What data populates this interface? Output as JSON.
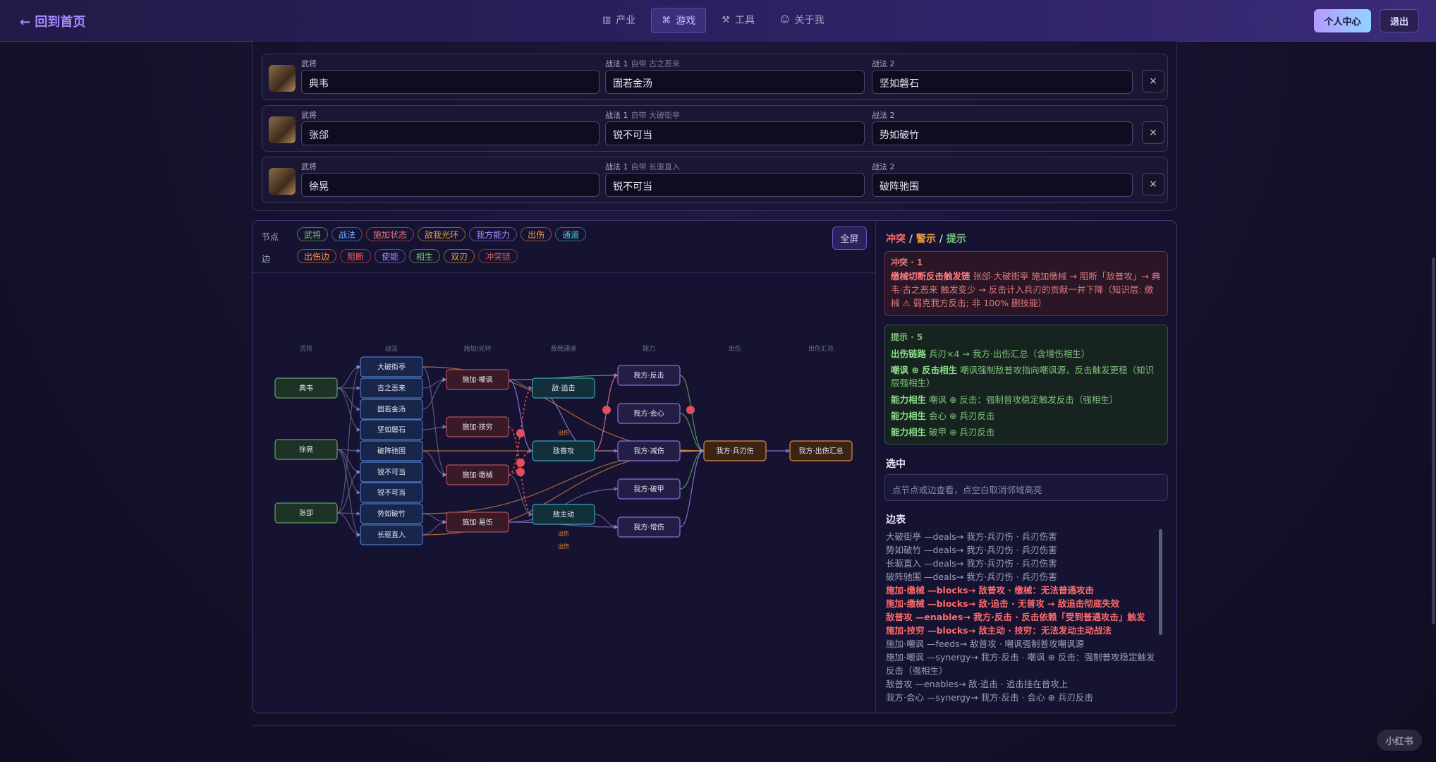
{
  "topbar": {
    "back_label": "← 回到首页",
    "nav": [
      {
        "icon": "bar-chart-icon",
        "glyph": "▥",
        "label": "产业"
      },
      {
        "icon": "gamepad-icon",
        "glyph": "⌘",
        "label": "游戏"
      },
      {
        "icon": "wrench-icon",
        "glyph": "⚒",
        "label": "工具"
      },
      {
        "icon": "user-icon",
        "glyph": "☺",
        "label": "关于我"
      }
    ],
    "profile_label": "个人中心",
    "logout_label": "退出"
  },
  "team": {
    "rows": [
      {
        "hero_label": "武将",
        "hero": "典韦",
        "skill1_label": "战法 1",
        "skill1_sub": "自带 古之恶来",
        "skill1": "固若金汤",
        "skill2_label": "战法 2",
        "skill2": "坚如磐石",
        "remove": "×"
      },
      {
        "hero_label": "武将",
        "hero": "张郃",
        "skill1_label": "战法 1",
        "skill1_sub": "自带 大破街亭",
        "skill1": "锐不可当",
        "skill2_label": "战法 2",
        "skill2": "势如破竹",
        "remove": "×"
      },
      {
        "hero_label": "武将",
        "hero": "徐晃",
        "skill1_label": "战法 1",
        "skill1_sub": "自带 长驱直入",
        "skill1": "锐不可当",
        "skill2_label": "战法 2",
        "skill2": "破阵驰围",
        "remove": "×"
      }
    ]
  },
  "filters": {
    "node_label": "节点",
    "edge_label": "边",
    "nodes": [
      {
        "label": "武将",
        "color": "#7ac27a"
      },
      {
        "label": "战法",
        "color": "#6fa8ff"
      },
      {
        "label": "施加状态",
        "color": "#e0707a"
      },
      {
        "label": "敌我光环",
        "color": "#e0a050"
      },
      {
        "label": "我方能力",
        "color": "#b08aff"
      },
      {
        "label": "出伤",
        "color": "#ff9a50"
      },
      {
        "label": "通道",
        "color": "#4fc3d8"
      }
    ],
    "edges": [
      {
        "label": "出伤边",
        "color": "#ff9a50"
      },
      {
        "label": "阻断",
        "color": "#ff5f5f"
      },
      {
        "label": "使能",
        "color": "#b08aff"
      },
      {
        "label": "相生",
        "color": "#7ac27a"
      },
      {
        "label": "双刃",
        "color": "#e0a050"
      },
      {
        "label": "冲突链",
        "color": "#e05a5a"
      }
    ],
    "fullscreen_label": "全屏"
  },
  "graph": {
    "columns": [
      "武将",
      "战法",
      "施加/光环",
      "敌我通道",
      "能力",
      "出伤",
      "出伤汇总"
    ],
    "nodes": [
      {
        "id": "hero-dianwei",
        "label": "典韦",
        "type": "hero"
      },
      {
        "id": "hero-xuhuang",
        "label": "徐晃",
        "type": "hero"
      },
      {
        "id": "hero-zhanghe",
        "label": "张郃",
        "type": "hero"
      },
      {
        "id": "sk-dapo",
        "label": "大破街亭",
        "type": "skill"
      },
      {
        "id": "sk-guzhi",
        "label": "古之恶来",
        "type": "skill"
      },
      {
        "id": "sk-guruo",
        "label": "固若金汤",
        "type": "skill"
      },
      {
        "id": "sk-jianru",
        "label": "坚如磐石",
        "type": "skill"
      },
      {
        "id": "sk-pozhen",
        "label": "破阵驰围",
        "type": "skill"
      },
      {
        "id": "sk-rui1",
        "label": "锐不可当",
        "type": "skill"
      },
      {
        "id": "sk-rui2",
        "label": "锐不可当",
        "type": "skill"
      },
      {
        "id": "sk-shiru",
        "label": "势如破竹",
        "type": "skill"
      },
      {
        "id": "sk-changqu",
        "label": "长驱直入",
        "type": "skill"
      },
      {
        "id": "st-chaofeng",
        "label": "施加·嘲讽",
        "type": "state"
      },
      {
        "id": "st-jiqiong",
        "label": "施加·技穷",
        "type": "state"
      },
      {
        "id": "st-jiaoxie",
        "label": "施加·缴械",
        "type": "state"
      },
      {
        "id": "st-yishang",
        "label": "施加·易伤",
        "type": "state"
      },
      {
        "id": "ch-zhuiji",
        "label": "敌·追击",
        "type": "channel"
      },
      {
        "id": "ch-putong",
        "label": "敌普攻",
        "type": "channel"
      },
      {
        "id": "ch-zhudong",
        "label": "敌主动",
        "type": "channel"
      },
      {
        "id": "ab-fanji",
        "label": "我方·反击",
        "type": "ability"
      },
      {
        "id": "ab-huixin",
        "label": "我方·会心",
        "type": "ability"
      },
      {
        "id": "ab-jianshang",
        "label": "我方·减伤",
        "type": "ability"
      },
      {
        "id": "ab-pojia",
        "label": "我方·破甲",
        "type": "ability"
      },
      {
        "id": "ab-zengshang",
        "label": "我方·增伤",
        "type": "ability"
      },
      {
        "id": "dmg-bingren",
        "label": "我方·兵刃伤",
        "type": "damage"
      },
      {
        "id": "dmg-total",
        "label": "我方·出伤汇总",
        "type": "total"
      }
    ],
    "edge_tags": [
      "出伤",
      "出伤",
      "出伤"
    ]
  },
  "sidebar": {
    "title_conflict": "冲突",
    "title_sep": " / ",
    "title_warn": "警示",
    "title_hint": "提示",
    "conflict_head": "冲突 · 1",
    "conflict_bold": "缴械切断反击触发链",
    "conflict_text": " 张郃·大破街亭 施加缴械 → 阻断「敌普攻」→ 典韦·古之恶来 触发变少 → 反击计入兵刃的贡献一并下降（知识层: 缴械 ⚠ 弱克我方反击; 非 100% 删技能）",
    "hint_head": "提示 · 5",
    "hints": [
      {
        "bold": "出伤链路",
        "text": " 兵刃×4 → 我方·出伤汇总（含增伤相生）"
      },
      {
        "bold": "嘲讽 ⊕ 反击相生",
        "text": " 嘲讽强制敌普攻指向嘲讽源，反击触发更稳（知识层强相生）"
      },
      {
        "bold": "能力相生",
        "text": " 嘲讽 ⊕ 反击：强制普攻稳定触发反击（强相生）"
      },
      {
        "bold": "能力相生",
        "text": " 会心 ⊕ 兵刃反击"
      },
      {
        "bold": "能力相生",
        "text": " 破甲 ⊕ 兵刃反击"
      }
    ],
    "selected_title": "选中",
    "selected_placeholder": "点节点或边查看，点空白取消邻域高亮",
    "edges_title": "边表",
    "edge_list": [
      {
        "text": "大破街亭 —deals→ 我方·兵刃伤 · 兵刃伤害",
        "red": false
      },
      {
        "text": "势如破竹 —deals→ 我方·兵刃伤 · 兵刃伤害",
        "red": false
      },
      {
        "text": "长驱直入 —deals→ 我方·兵刃伤 · 兵刃伤害",
        "red": false
      },
      {
        "text": "破阵驰围 —deals→ 我方·兵刃伤 · 兵刃伤害",
        "red": false
      },
      {
        "text": "施加·缴械 —blocks→ 敌普攻 · 缴械：无法普通攻击",
        "red": true
      },
      {
        "text": "施加·缴械 —blocks→ 敌·追击 · 无普攻 → 敌追击彻底失效",
        "red": true
      },
      {
        "text": "敌普攻 —enables→ 我方·反击 · 反击依赖「受到普通攻击」触发",
        "red": true
      },
      {
        "text": "施加·技穷 —blocks→ 敌主动 · 技穷：无法发动主动战法",
        "red": true
      },
      {
        "text": "施加·嘲讽 —feeds→ 敌普攻 · 嘲讽强制普攻嘲讽源",
        "red": false
      },
      {
        "text": "施加·嘲讽 —synergy→ 我方·反击 · 嘲讽 ⊕ 反击：强制普攻稳定触发反击（强相生）",
        "red": false
      },
      {
        "text": "敌普攻 —enables→ 敌·追击 · 追击挂在普攻上",
        "red": false
      },
      {
        "text": "我方·会心 —synergy→ 我方·反击 · 会心 ⊕ 兵刃反击",
        "red": false
      }
    ]
  },
  "watermark": "小红书"
}
